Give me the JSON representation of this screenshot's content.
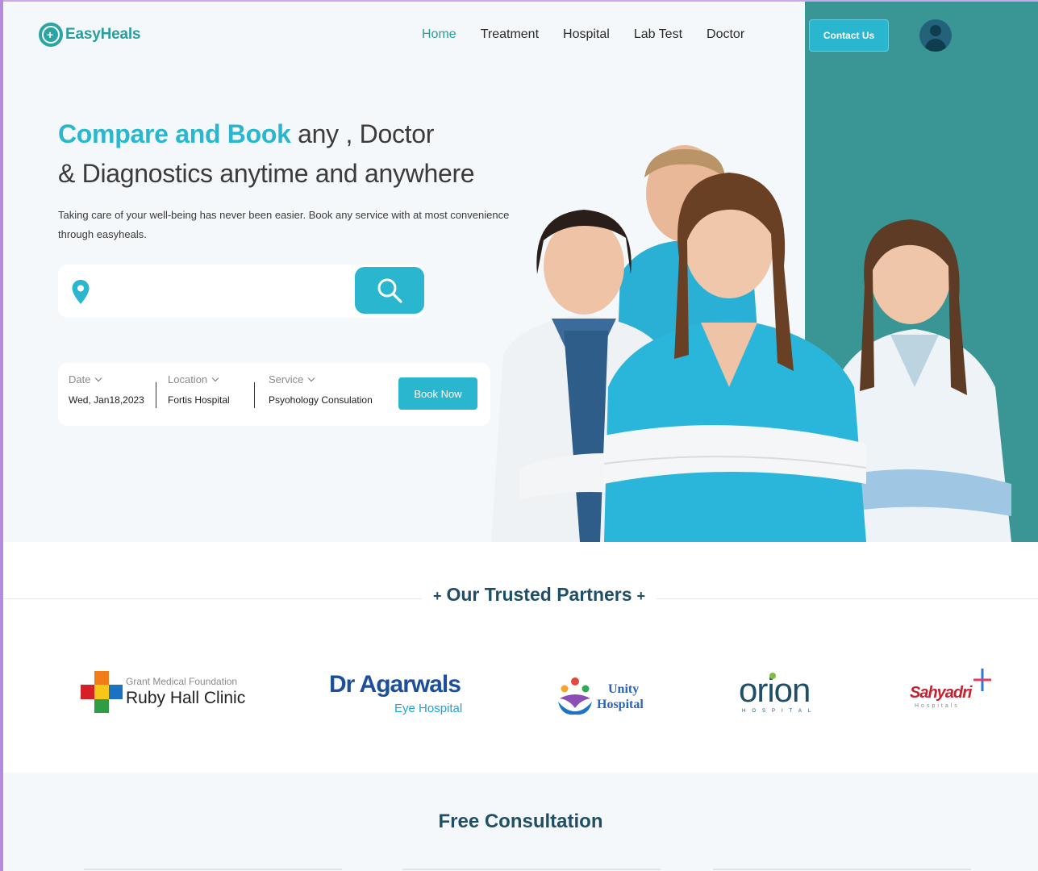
{
  "brand": {
    "name": "EasyHeals"
  },
  "nav": {
    "items": [
      {
        "label": "Home",
        "active": true
      },
      {
        "label": "Treatment",
        "active": false
      },
      {
        "label": "Hospital",
        "active": false
      },
      {
        "label": "Lab Test",
        "active": false
      },
      {
        "label": "Doctor",
        "active": false
      }
    ],
    "contact_label": "Contact Us"
  },
  "hero": {
    "headline_accent": "Compare and Book",
    "headline_rest": " any , Doctor",
    "headline_line2": "& Diagnostics anytime and anywhere",
    "subcopy": "Taking care of your well-being has never been easier. Book any service with at most convenience through easyheals."
  },
  "search": {
    "value": "",
    "placeholder": ""
  },
  "booking": {
    "date_label": "Date",
    "date_value": "Wed, Jan18,2023",
    "location_label": "Location",
    "location_value": "Fortis Hospital",
    "service_label": "Service",
    "service_value": "Psyohology Consulation",
    "book_label": "Book Now"
  },
  "partners": {
    "title": "Our Trusted Partners",
    "ruby_small": "Grant Medical Foundation",
    "ruby_big": "Ruby Hall Clinic",
    "agarwal_big": "Dr Agarwals",
    "agarwal_small": "Eye Hospital",
    "unity_1": "Unity",
    "unity_2": "Hospital",
    "orion_big": "orion",
    "orion_small": "HOSPITAL",
    "sahyadri_big": "Sahyadri",
    "sahyadri_small": "Hospitals"
  },
  "consultation": {
    "title": "Free Consultation"
  },
  "colors": {
    "accent": "#2bb6cf",
    "brand_teal": "#2a9d9d",
    "panel_teal": "#3a9595",
    "heading_navy": "#1f4f66"
  }
}
